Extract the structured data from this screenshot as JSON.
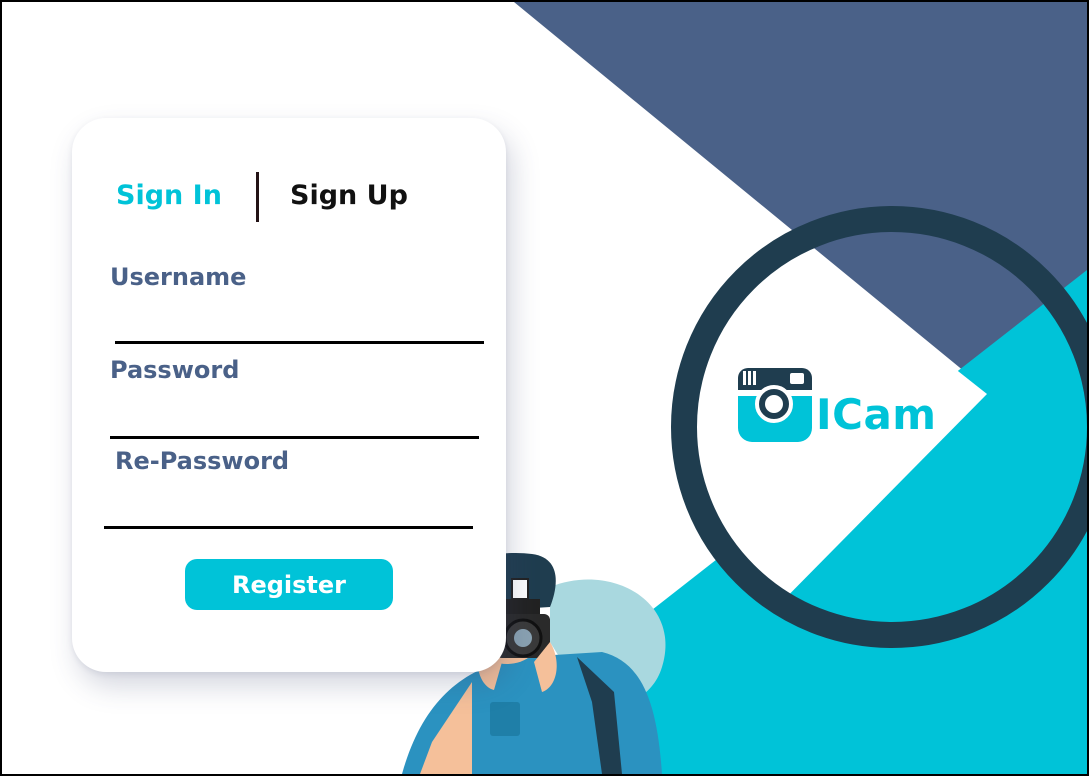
{
  "tabs": {
    "signin": "Sign In",
    "signup": "Sign Up",
    "active": "signin"
  },
  "form": {
    "username_label": "Username",
    "password_label": "Password",
    "repassword_label": "Re-Password",
    "username_value": "",
    "password_value": "",
    "repassword_value": "",
    "register_label": "Register"
  },
  "brand": {
    "name": "ICam",
    "logo_icon": "camera-icon"
  },
  "illustration": {
    "subject": "photographer-illustration"
  },
  "colors": {
    "accent": "#00c3d8",
    "navy": "#4a6188",
    "dark_ring": "#1f3d4f",
    "label": "#4a6188",
    "text_dark": "#111111"
  }
}
